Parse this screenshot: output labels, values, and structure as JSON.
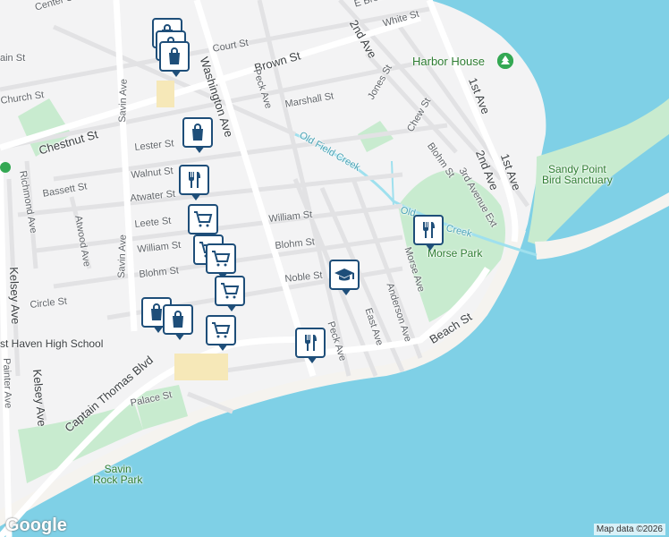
{
  "map": {
    "colors": {
      "water": "#7fd0e6",
      "land": "#f3f3f4",
      "park": "#c8ebcf",
      "road": "#ffffff",
      "road_minor": "#e2e2e4",
      "beach": "#f5f3ef",
      "creek": "#9fe0ee",
      "pin_border": "#1e4e79",
      "poi": "#34a853"
    },
    "streets": {
      "center_st": "Center St",
      "brown_st": "Brown St",
      "court_st": "Court St",
      "main_st": "ain St",
      "church_st": "Church St",
      "chestnut_st": "Chestnut St",
      "lester_st": "Lester St",
      "walnut_st": "Walnut St",
      "atwater_st": "Atwater St",
      "leete_st": "Leete St",
      "william_st_w": "William St",
      "blohm_st_w": "Blohm St",
      "william_st_e": "William St",
      "blohm_st_e": "Blohm St",
      "noble_st": "Noble St",
      "marshall_st": "Marshall St",
      "white_st": "White St",
      "jones_st": "Jones St",
      "chew_st": "Chew St",
      "blohm_st_ne": "Blohm St",
      "second_ave_n": "2nd Ave",
      "first_ave": "1st Ave",
      "second_ave_s": "2nd Ave",
      "third_ave_ext": "3rd Avenue Ext",
      "first_ave_s": "1st Ave",
      "washington_ave": "Washington Ave",
      "peck_ave_n": "Peck Ave",
      "peck_ave_s": "Peck Ave",
      "savin_ave_n": "Savin Ave",
      "savin_ave_s": "Savin Ave",
      "richmond_ave": "Richmond Ave",
      "bassett_st": "Bassett St",
      "atwood_ave": "Atwood Ave",
      "kelsey_ave": "Kelsey Ave",
      "kelsey_ave_s": "Kelsey Ave",
      "circle_st": "Circle St",
      "painter_ave": "Painter Ave",
      "captain_thomas": "Captain Thomas Blvd",
      "palace_st": "Palace St",
      "east_ave": "East Ave",
      "anderson_ave": "Anderson Ave",
      "morse_ave": "Morse Ave",
      "beach_st": "Beach St",
      "e_broad": "E Broad"
    },
    "places": {
      "harbor_house": "Harbor House",
      "sandy_point": "Sandy Point\nBird Sanctuary",
      "morse_park": "Morse Park",
      "savin_rock": "Savin\nRock Park",
      "high_school": "st Haven High School",
      "old_field_creek": "Old Field Creek",
      "old_creek_2a": "Old",
      "old_creek_2b": "Creek"
    },
    "pins": [
      {
        "type": "shopping",
        "name": "shopping"
      },
      {
        "type": "shopping",
        "name": "shopping"
      },
      {
        "type": "shopping",
        "name": "shopping"
      },
      {
        "type": "restaurant",
        "name": "restaurant"
      },
      {
        "type": "grocery",
        "name": "grocery"
      },
      {
        "type": "grocery",
        "name": "grocery"
      },
      {
        "type": "grocery",
        "name": "grocery"
      },
      {
        "type": "restaurant",
        "name": "restaurant"
      },
      {
        "type": "school",
        "name": "school"
      },
      {
        "type": "shopping",
        "name": "shopping"
      },
      {
        "type": "shopping",
        "name": "shopping"
      },
      {
        "type": "grocery",
        "name": "grocery"
      },
      {
        "type": "restaurant",
        "name": "restaurant"
      },
      {
        "type": "restaurant",
        "name": "restaurant"
      }
    ],
    "google": "Google",
    "attribution": "Map data ©2026"
  }
}
